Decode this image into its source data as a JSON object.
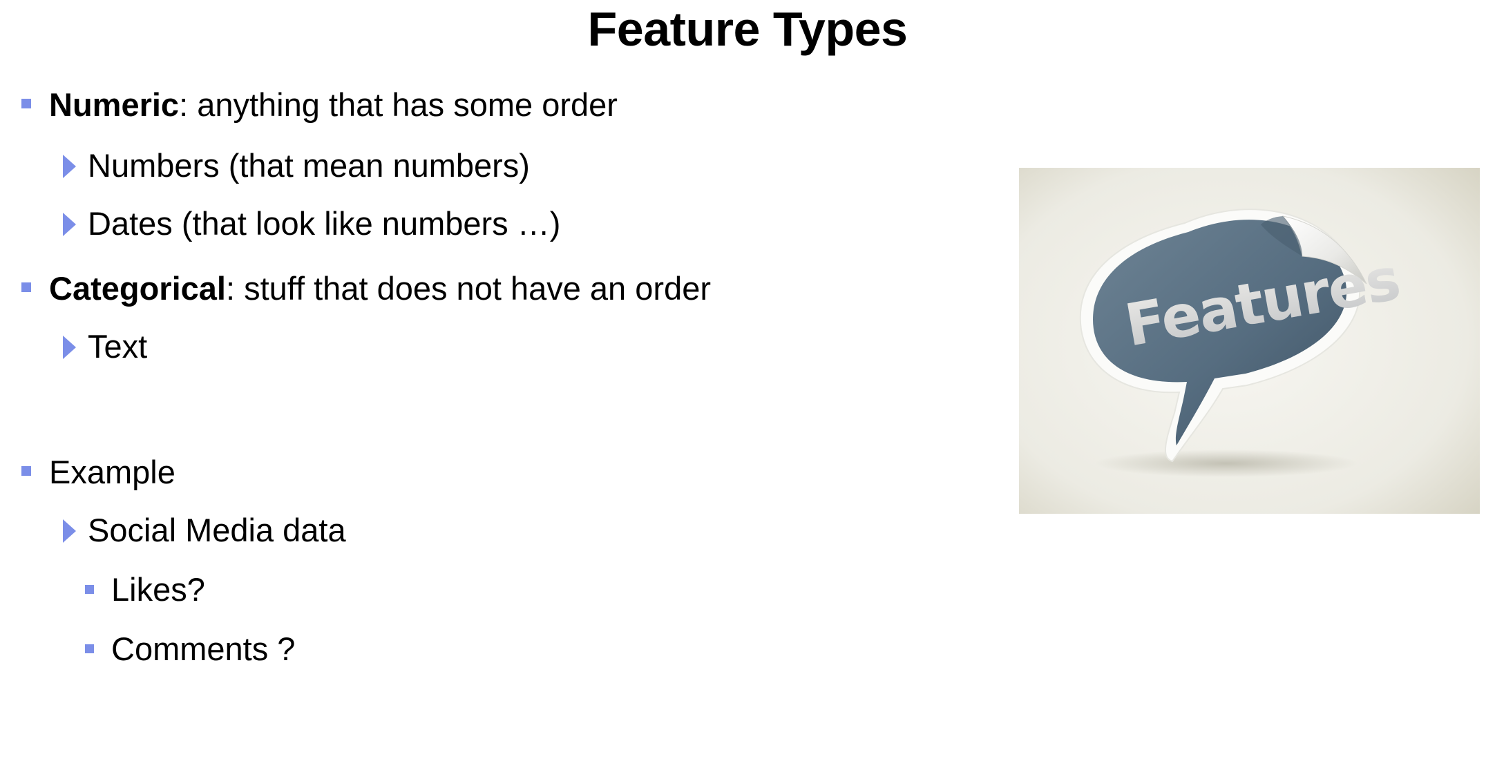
{
  "slide": {
    "title": "Feature Types",
    "bullets": [
      {
        "bold": "Numeric",
        "text": ": anything that has some order",
        "children": [
          {
            "text": "Numbers (that mean numbers)"
          },
          {
            "text": "Dates (that look like numbers …)"
          }
        ]
      },
      {
        "bold": "Categorical",
        "text": ": stuff that does not have an order",
        "children": [
          {
            "text": "Text"
          }
        ]
      },
      {
        "text": "Example",
        "children": [
          {
            "text": "Social Media data",
            "children": [
              {
                "text": "Likes?"
              },
              {
                "text": "Comments ?"
              }
            ]
          }
        ]
      }
    ],
    "image": {
      "label": "Features",
      "icon": "speech-bubble-sticker-image"
    },
    "colors": {
      "bullet": "#7b8ee8",
      "bubble": "#5a7183",
      "image_bg": "#ecebe3"
    }
  }
}
